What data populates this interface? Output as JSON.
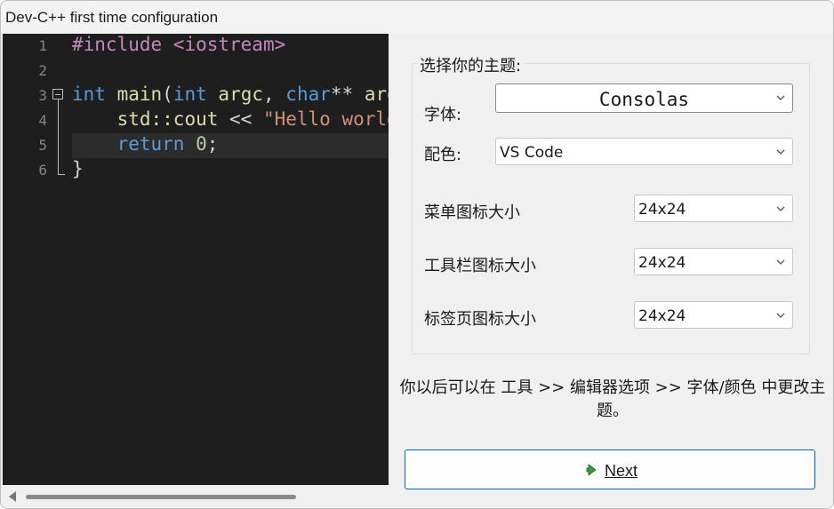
{
  "window": {
    "title": "Dev-C++ first time configuration"
  },
  "editor": {
    "line_numbers": [
      "1",
      "2",
      "3",
      "4",
      "5",
      "6"
    ],
    "lines": [
      [
        {
          "t": "#include ",
          "c": "pp"
        },
        {
          "t": "<iostream>",
          "c": "pp"
        }
      ],
      [],
      [
        {
          "t": "int",
          "c": "kw"
        },
        {
          "t": " ",
          "c": ""
        },
        {
          "t": "main",
          "c": "fn"
        },
        {
          "t": "(",
          "c": ""
        },
        {
          "t": "int",
          "c": "kw"
        },
        {
          "t": " ",
          "c": ""
        },
        {
          "t": "argc",
          "c": "fn"
        },
        {
          "t": ", ",
          "c": ""
        },
        {
          "t": "char",
          "c": "kw"
        },
        {
          "t": "** ",
          "c": ""
        },
        {
          "t": "argv",
          "c": "fn"
        },
        {
          "t": ") {",
          "c": ""
        }
      ],
      [
        {
          "t": "    std::",
          "c": "fn"
        },
        {
          "t": "cout",
          "c": "fn"
        },
        {
          "t": " << ",
          "c": ""
        },
        {
          "t": "\"Hello world\\n\"",
          "c": "str"
        },
        {
          "t": ";",
          "c": ""
        }
      ],
      [
        {
          "t": "    ",
          "c": ""
        },
        {
          "t": "return",
          "c": "kw"
        },
        {
          "t": " ",
          "c": ""
        },
        {
          "t": "0",
          "c": "num"
        },
        {
          "t": ";",
          "c": ""
        }
      ],
      [
        {
          "t": "}",
          "c": ""
        }
      ]
    ]
  },
  "theme": {
    "group_title": "选择你的主题:",
    "font_label": "字体:",
    "font_value": "Consolas",
    "color_label": "配色:",
    "color_value": "VS Code",
    "menu_icon_label": "菜单图标大小",
    "menu_icon_value": "24x24",
    "toolbar_icon_label": "工具栏图标大小",
    "toolbar_icon_value": "24x24",
    "tab_icon_label": "标签页图标大小",
    "tab_icon_value": "24x24"
  },
  "hint": "你以后可以在 工具 >> 编辑器选项 >> 字体/颜色 中更改主题。",
  "next_button": {
    "label": "Next",
    "icon": "chevron-right-green-icon"
  },
  "colors": {
    "editor_bg": "#1e1e1e",
    "accent": "#0067c0",
    "keyword": "#569cd6",
    "preprocessor": "#c586c0",
    "string": "#ce9178",
    "number": "#b5cea8"
  }
}
